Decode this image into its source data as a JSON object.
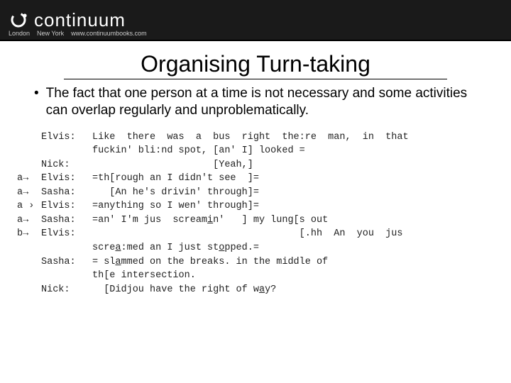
{
  "header": {
    "brand": "continuum",
    "cities": [
      "London",
      "New York"
    ],
    "site": "www.continuumbooks.com"
  },
  "title": "Organising Turn-taking",
  "bullet": {
    "text": "The fact that one person at a time is not necessary and some activities can overlap regularly and unproblematically."
  },
  "transcript": [
    {
      "mark": "",
      "spk": "Elvis:",
      "text": "Like  there  was  a  bus  right  the:re  man,  in  that"
    },
    {
      "mark": "",
      "spk": "",
      "text": "fuckin' bli:nd spot, [an' I] looked ="
    },
    {
      "mark": "",
      "spk": "Nick:",
      "text": "                     [Yeah,]"
    },
    {
      "mark": "a→",
      "spk": "Elvis:",
      "text": "=th[rough an I didn't see  ]="
    },
    {
      "mark": "a→",
      "spk": "Sasha:",
      "text": "   [An he's drivin' through]="
    },
    {
      "mark": "a ›",
      "spk": "Elvis:",
      "text": "=anything so I wen' through]="
    },
    {
      "mark": "a→",
      "spk": "Sasha:",
      "text": "=an' I'm jus  screami_n'   ] my lung[s out"
    },
    {
      "mark": "b→",
      "spk": "Elvis:",
      "text": "                                    [.hh  An  you  jus"
    },
    {
      "mark": "",
      "spk": "",
      "text": ""
    },
    {
      "mark": "",
      "spk": "",
      "text": "screa_:med an I just sto_pped.="
    },
    {
      "mark": "",
      "spk": "Sasha:",
      "text": "= sla_mmed on the breaks. in the middle of"
    },
    {
      "mark": "",
      "spk": "",
      "text": "th[e intersection."
    },
    {
      "mark": "",
      "spk": "Nick:",
      "text": "  [Didjou have the right of wa_y?"
    }
  ],
  "labels": {
    "bullet_dot": "•"
  }
}
